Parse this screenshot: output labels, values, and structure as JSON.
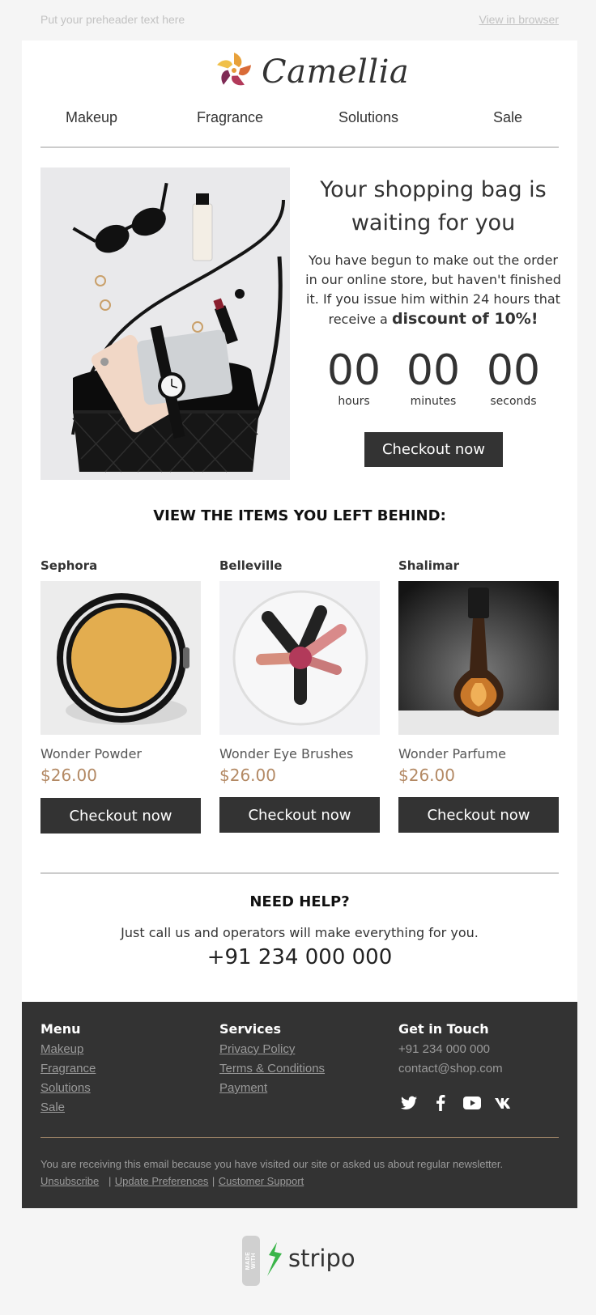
{
  "preheader": {
    "text": "Put your preheader text here",
    "view_in_browser": "View in browser"
  },
  "header": {
    "brand": "Camellia",
    "nav": [
      "Makeup",
      "Fragrance",
      "Solutions",
      "Sale"
    ]
  },
  "hero": {
    "title_line1": "Your shopping bag is",
    "title_line2": "waiting for you",
    "body_line1": "You have begun to make out the order",
    "body_line2": "in our online store, but haven't finished",
    "body_line3": "it. If you issue him within 24 hours that",
    "body_line4_prefix": "receive a ",
    "discount": "discount of 10%!",
    "countdown": [
      {
        "value": "00",
        "label": "hours"
      },
      {
        "value": "00",
        "label": "minutes"
      },
      {
        "value": "00",
        "label": "seconds"
      }
    ],
    "button": "Checkout now"
  },
  "products_section": {
    "title": "VIEW THE ITEMS YOU LEFT BEHIND:",
    "items": [
      {
        "brand": "Sephora",
        "name": "Wonder Powder",
        "price": "$26.00",
        "button": "Checkout now"
      },
      {
        "brand": "Belleville",
        "name": "Wonder Eye Brushes",
        "price": "$26.00",
        "button": "Checkout now"
      },
      {
        "brand": "Shalimar",
        "name": "Wonder Parfume",
        "price": "$26.00",
        "button": "Checkout now"
      }
    ]
  },
  "help": {
    "title": "NEED HELP?",
    "text": "Just call us and operators will make everything for you.",
    "phone": "+91 234 000 000"
  },
  "footer": {
    "menu": {
      "title": "Menu",
      "links": [
        "Makeup",
        "Fragrance",
        "Solutions",
        "Sale"
      ]
    },
    "services": {
      "title": "Services",
      "links": [
        "Privacy Policy",
        "Terms & Conditions",
        "Payment"
      ]
    },
    "contact": {
      "title": "Get in Touch",
      "phone": "+91 234 000 000",
      "email": "contact@shop.com"
    },
    "social_icons": [
      "twitter-icon",
      "facebook-icon",
      "youtube-icon",
      "vk-icon"
    ],
    "note": "You are receiving this email because you have visited our site or asked us about regular newsletter.",
    "unsubscribe": "Unsubscribe",
    "update_preferences": "Update Preferences",
    "customer_support": "Customer Support",
    "separator": "|"
  },
  "badge": {
    "made_with": "MADE WITH",
    "name": "stripo"
  },
  "colors": {
    "dark": "#333333",
    "price": "#b38964",
    "background": "#f5f5f5"
  }
}
